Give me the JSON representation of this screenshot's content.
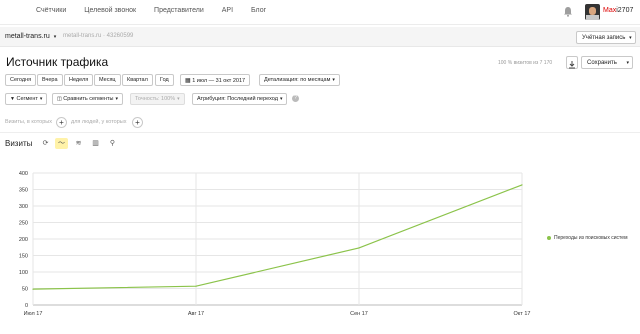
{
  "topnav": [
    "Счётчики",
    "Целевой звонок",
    "Представители",
    "API",
    "Блог"
  ],
  "user": {
    "first": "Max",
    "rest": "i2707"
  },
  "site": {
    "name": "metall-trans.ru",
    "crumb": "metall-trans.ru · 43260599"
  },
  "account_button": "Учётная запись",
  "page_title": "Источник трафика",
  "visits_pct": "100 % визитов из 7 170",
  "save_button": "Сохранить",
  "period_buttons": [
    "Сегодня",
    "Вчера",
    "Неделя",
    "Месяц",
    "Квартал",
    "Год"
  ],
  "date_range": "1 июл — 31 окт 2017",
  "detail": "Детализация: по месяцам",
  "segment": "Сегмент",
  "compare": "Сравнить сегменты",
  "accuracy": "Точность: 100%",
  "attribution": "Атрибуция: Последний переход",
  "segment_visits": "Визиты, в которых",
  "segment_people": "для людей, у которых",
  "chart_title": "Визиты",
  "colors": {
    "series": "#8bc34a",
    "active_tool": "#fff2a8"
  },
  "chart_data": {
    "type": "line",
    "x": [
      "Июл 17",
      "Авг 17",
      "Сен 17",
      "Окт 17"
    ],
    "series": [
      {
        "name": "Переходы из поисковых систем",
        "values": [
          48,
          57,
          173,
          364
        ]
      }
    ],
    "yticks": [
      0,
      50,
      100,
      150,
      200,
      250,
      300,
      350,
      400
    ],
    "ylim": [
      0,
      400
    ],
    "grid": true,
    "legend": "right"
  }
}
